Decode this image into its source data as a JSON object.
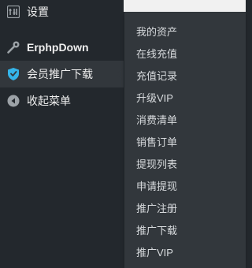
{
  "sidebar": {
    "items": [
      {
        "label": "设置",
        "icon": "settings-icon"
      },
      {
        "label": "ErphpDown",
        "icon": "wrench-icon"
      },
      {
        "label": "会员推广下载",
        "icon": "shield-icon",
        "active": true
      },
      {
        "label": "收起菜单",
        "icon": "collapse-arrow-icon"
      }
    ]
  },
  "submenu": {
    "items": [
      "我的资产",
      "在线充值",
      "充值记录",
      "升级VIP",
      "消费清单",
      "销售订单",
      "提现列表",
      "申请提现",
      "推广注册",
      "推广下载",
      "推广VIP"
    ]
  },
  "colors": {
    "sidebar_bg": "#23282d",
    "submenu_bg": "#32373c",
    "active_text": "#35b5ea",
    "text": "#eeeeee"
  }
}
